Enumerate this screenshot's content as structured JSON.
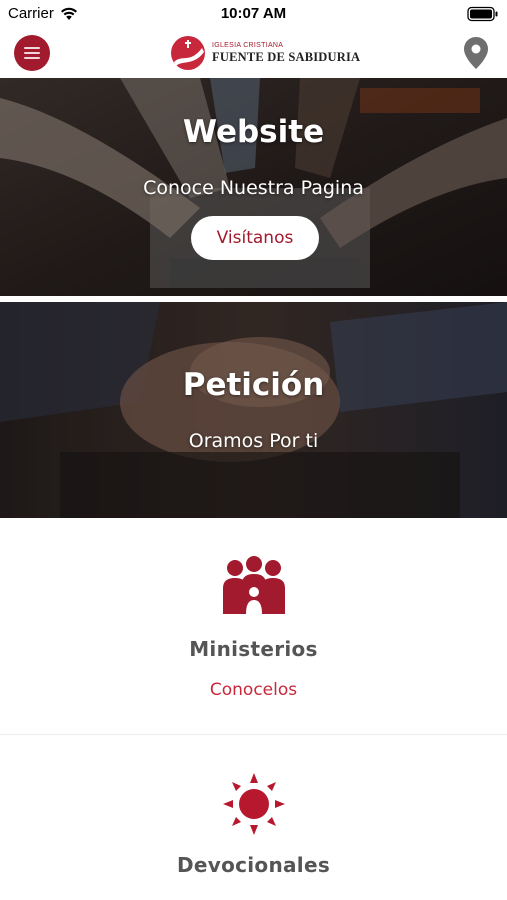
{
  "status_bar": {
    "carrier": "Carrier",
    "time": "10:07 AM"
  },
  "header": {
    "menu_icon": "hamburger-menu-icon",
    "logo_subtitle": "IGLESIA CRISTIANA",
    "logo_title": "FUENTE DE SABIDURIA",
    "location_icon": "map-pin-icon"
  },
  "website_card": {
    "title": "Website",
    "subtitle": "Conoce Nuestra Pagina",
    "button_label": "Visítanos"
  },
  "peticion_card": {
    "title": "Petición",
    "subtitle": "Oramos Por ti"
  },
  "ministerios": {
    "icon": "people-group-icon",
    "title": "Ministerios",
    "link": "Conocelos"
  },
  "devocionales": {
    "icon": "sun-icon",
    "title": "Devocionales"
  },
  "colors": {
    "brand": "#a11a2e",
    "link": "#c8283c",
    "section_title": "#555555"
  }
}
